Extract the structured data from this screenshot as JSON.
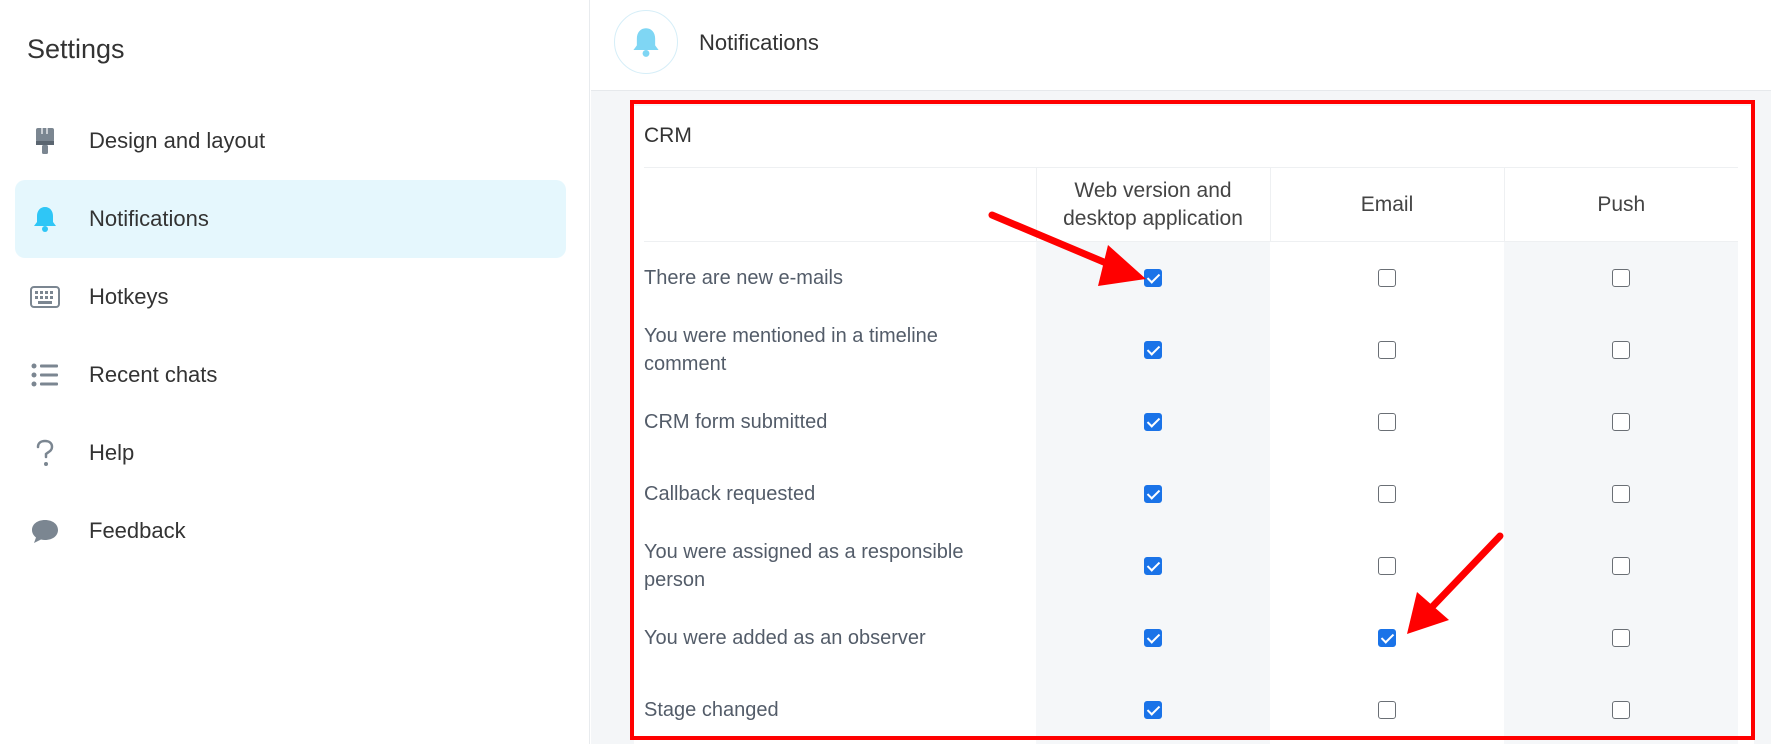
{
  "sidebar": {
    "title": "Settings",
    "items": [
      {
        "label": "Design and layout",
        "icon": "brush-icon",
        "active": false
      },
      {
        "label": "Notifications",
        "icon": "bell-icon",
        "active": true
      },
      {
        "label": "Hotkeys",
        "icon": "keyboard-icon",
        "active": false
      },
      {
        "label": "Recent chats",
        "icon": "list-icon",
        "active": false
      },
      {
        "label": "Help",
        "icon": "question-icon",
        "active": false
      },
      {
        "label": "Feedback",
        "icon": "speech-bubble-icon",
        "active": false
      }
    ]
  },
  "header": {
    "title": "Notifications",
    "icon": "bell-icon"
  },
  "section": {
    "title": "CRM",
    "columns": [
      "",
      "Web version and desktop application",
      "Email",
      "Push"
    ],
    "rows": [
      {
        "label": "There are new e-mails",
        "web": true,
        "email": false,
        "push": false
      },
      {
        "label": "You were mentioned in a timeline comment",
        "web": true,
        "email": false,
        "push": false
      },
      {
        "label": "CRM form submitted",
        "web": true,
        "email": false,
        "push": false
      },
      {
        "label": "Callback requested",
        "web": true,
        "email": false,
        "push": false
      },
      {
        "label": "You were assigned as a responsible person",
        "web": true,
        "email": false,
        "push": false
      },
      {
        "label": "You were added as an observer",
        "web": true,
        "email": true,
        "push": false
      },
      {
        "label": "Stage changed",
        "web": true,
        "email": false,
        "push": false
      }
    ]
  },
  "colors": {
    "accent": "#1a73e8",
    "active_bg": "#e5f7fd",
    "icon_blue": "#2fc6f6",
    "annotation": "#ff0000"
  }
}
